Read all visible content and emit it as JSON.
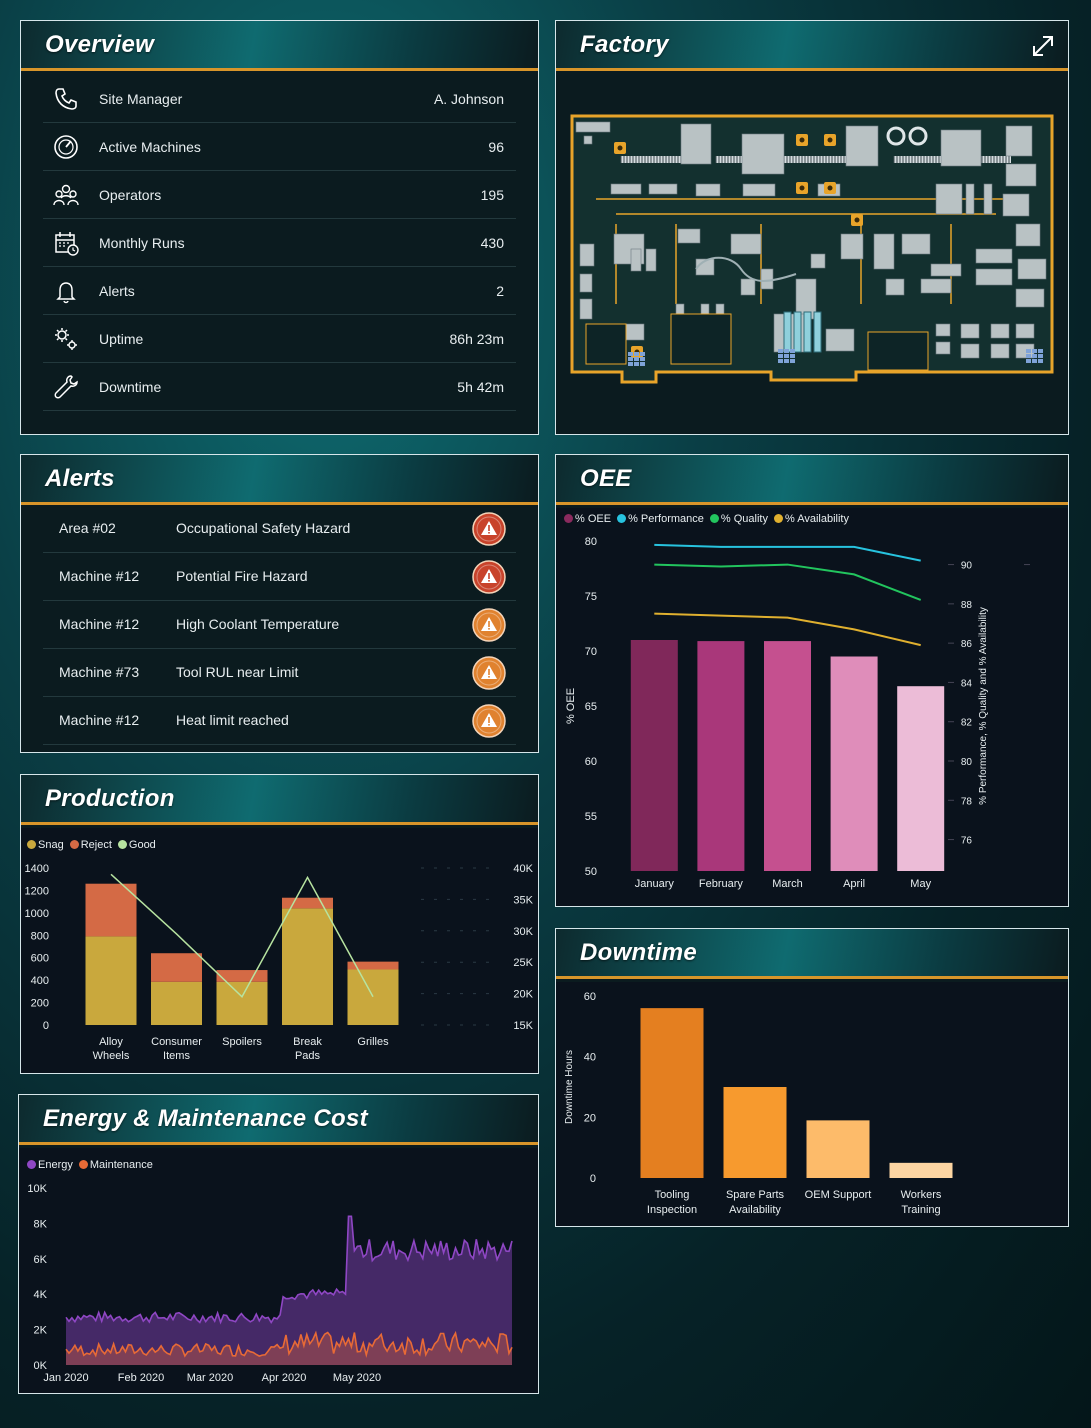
{
  "overview": {
    "title": "Overview",
    "rows": [
      {
        "icon": "phone-icon",
        "label": "Site Manager",
        "value": "A. Johnson"
      },
      {
        "icon": "gauge-icon",
        "label": "Active Machines",
        "value": "96"
      },
      {
        "icon": "users-icon",
        "label": "Operators",
        "value": "195"
      },
      {
        "icon": "calendar-icon",
        "label": "Monthly Runs",
        "value": "430"
      },
      {
        "icon": "bell-icon",
        "label": "Alerts",
        "value": "2"
      },
      {
        "icon": "gears-icon",
        "label": "Uptime",
        "value": "86h 23m"
      },
      {
        "icon": "wrench-icon",
        "label": "Downtime",
        "value": "5h 42m"
      }
    ]
  },
  "factory": {
    "title": "Factory",
    "expand_icon": "expand-icon"
  },
  "alerts": {
    "title": "Alerts",
    "rows": [
      {
        "area": "Area #02",
        "message": "Occupational Safety Hazard",
        "severity": "high",
        "color": "#c8432b"
      },
      {
        "area": "Machine #12",
        "message": "Potential Fire Hazard",
        "severity": "high",
        "color": "#c8432b"
      },
      {
        "area": "Machine #12",
        "message": "High Coolant Temperature",
        "severity": "medium",
        "color": "#e0822f"
      },
      {
        "area": "Machine #73",
        "message": "Tool RUL near Limit",
        "severity": "medium",
        "color": "#e0822f"
      },
      {
        "area": "Machine #12",
        "message": "Heat limit reached",
        "severity": "medium",
        "color": "#e0822f"
      }
    ]
  },
  "oee": {
    "title": "OEE",
    "legend": [
      {
        "name": "% OEE",
        "color": "#8a2a5e"
      },
      {
        "name": "% Performance",
        "color": "#27c3df"
      },
      {
        "name": "% Quality",
        "color": "#22c55e"
      },
      {
        "name": "% Availability",
        "color": "#e0b02f"
      }
    ]
  },
  "production": {
    "title": "Production",
    "legend": [
      {
        "name": "Snag",
        "color": "#c9a83d"
      },
      {
        "name": "Reject",
        "color": "#d46a45"
      },
      {
        "name": "Good",
        "color": "#b7e3a0"
      }
    ]
  },
  "downtime": {
    "title": "Downtime"
  },
  "energy": {
    "title": "Energy & Maintenance Cost",
    "legend": [
      {
        "name": "Energy",
        "color": "#8f47c4"
      },
      {
        "name": "Maintenance",
        "color": "#e86a36"
      }
    ]
  },
  "chart_data": [
    {
      "id": "oee",
      "type": "bar",
      "categories": [
        "January",
        "February",
        "March",
        "April",
        "May"
      ],
      "ylabel": "% OEE",
      "y2label": "% Performance, % Quality and % Availability",
      "ylim": [
        50,
        80
      ],
      "yticks": [
        50,
        55,
        60,
        65,
        70,
        75,
        80
      ],
      "y2lim": [
        74.4,
        91.2
      ],
      "y2ticks": [
        76,
        78,
        80,
        82,
        84,
        86,
        88,
        90
      ],
      "series": [
        {
          "name": "% OEE",
          "kind": "bar",
          "axis": "left",
          "values": [
            71.0,
            70.9,
            70.9,
            69.5,
            66.8
          ],
          "colors": [
            "#80285a",
            "#a9377a",
            "#c5508f",
            "#df8dba",
            "#ecbcd7"
          ]
        },
        {
          "name": "% Performance",
          "kind": "line",
          "axis": "right",
          "color": "#27c3df",
          "values": [
            91.0,
            90.9,
            90.9,
            90.9,
            90.2
          ]
        },
        {
          "name": "% Quality",
          "kind": "line",
          "axis": "right",
          "color": "#22c55e",
          "values": [
            90.0,
            89.9,
            90.0,
            89.5,
            88.2
          ]
        },
        {
          "name": "% Availability",
          "kind": "line",
          "axis": "right",
          "color": "#e0b02f",
          "values": [
            87.5,
            87.4,
            87.3,
            86.7,
            85.9
          ]
        }
      ]
    },
    {
      "id": "production",
      "type": "bar",
      "categories": [
        "Alloy Wheels",
        "Consumer Items",
        "Spoilers",
        "Break Pads",
        "Grilles"
      ],
      "ylim": [
        0,
        1400
      ],
      "yticks": [
        0,
        200,
        400,
        600,
        800,
        1000,
        1200,
        1400
      ],
      "y2lim": [
        15000,
        40000
      ],
      "y2ticks": [
        "15K",
        "20K",
        "25K",
        "30K",
        "35K",
        "40K"
      ],
      "series": [
        {
          "name": "Snag",
          "kind": "stacked-bar",
          "color": "#c9a83d",
          "values": [
            790,
            385,
            385,
            1040,
            495
          ]
        },
        {
          "name": "Reject",
          "kind": "stacked-bar",
          "color": "#d46a45",
          "values": [
            470,
            255,
            105,
            95,
            70
          ]
        },
        {
          "name": "Good",
          "kind": "line",
          "axis": "right",
          "color": "#b7e3a0",
          "values": [
            39000,
            29500,
            19500,
            38500,
            19500
          ]
        }
      ]
    },
    {
      "id": "downtime",
      "type": "bar",
      "categories": [
        "Tooling Inspection",
        "Spare Parts Availability",
        "OEM Support",
        "Workers Training"
      ],
      "ylabel": "Downtime Hours",
      "ylim": [
        0,
        60
      ],
      "yticks": [
        0,
        20,
        40,
        60
      ],
      "values": [
        56,
        30,
        19,
        5
      ],
      "colors": [
        "#e47f20",
        "#f79a2e",
        "#fdbb6a",
        "#fdd5a2"
      ]
    },
    {
      "id": "energy",
      "type": "area",
      "x": [
        "Jan 2020",
        "Feb 2020",
        "Mar 2020",
        "Apr 2020",
        "May 2020"
      ],
      "ylim": [
        0,
        10000
      ],
      "yticks": [
        "0K",
        "2K",
        "4K",
        "6K",
        "8K",
        "10K"
      ],
      "series": [
        {
          "name": "Energy",
          "color": "#8f47c4",
          "segments": [
            {
              "from": "Jan 2020",
              "to": "Apr 2020",
              "approx": 2700
            },
            {
              "from": "Apr 2020",
              "to": "Apr 20 2020",
              "approx": 4000
            },
            {
              "from": "Apr 20 2020",
              "to": "Jun 2020",
              "approx": 6600
            }
          ],
          "peak": 8400
        },
        {
          "name": "Maintenance",
          "color": "#e86a36",
          "segments": [
            {
              "from": "Jan 2020",
              "to": "Apr 2020",
              "approx": 900
            },
            {
              "from": "Apr 2020",
              "to": "Jun 2020",
              "approx": 1200
            }
          ],
          "peak": 2300
        }
      ]
    }
  ]
}
